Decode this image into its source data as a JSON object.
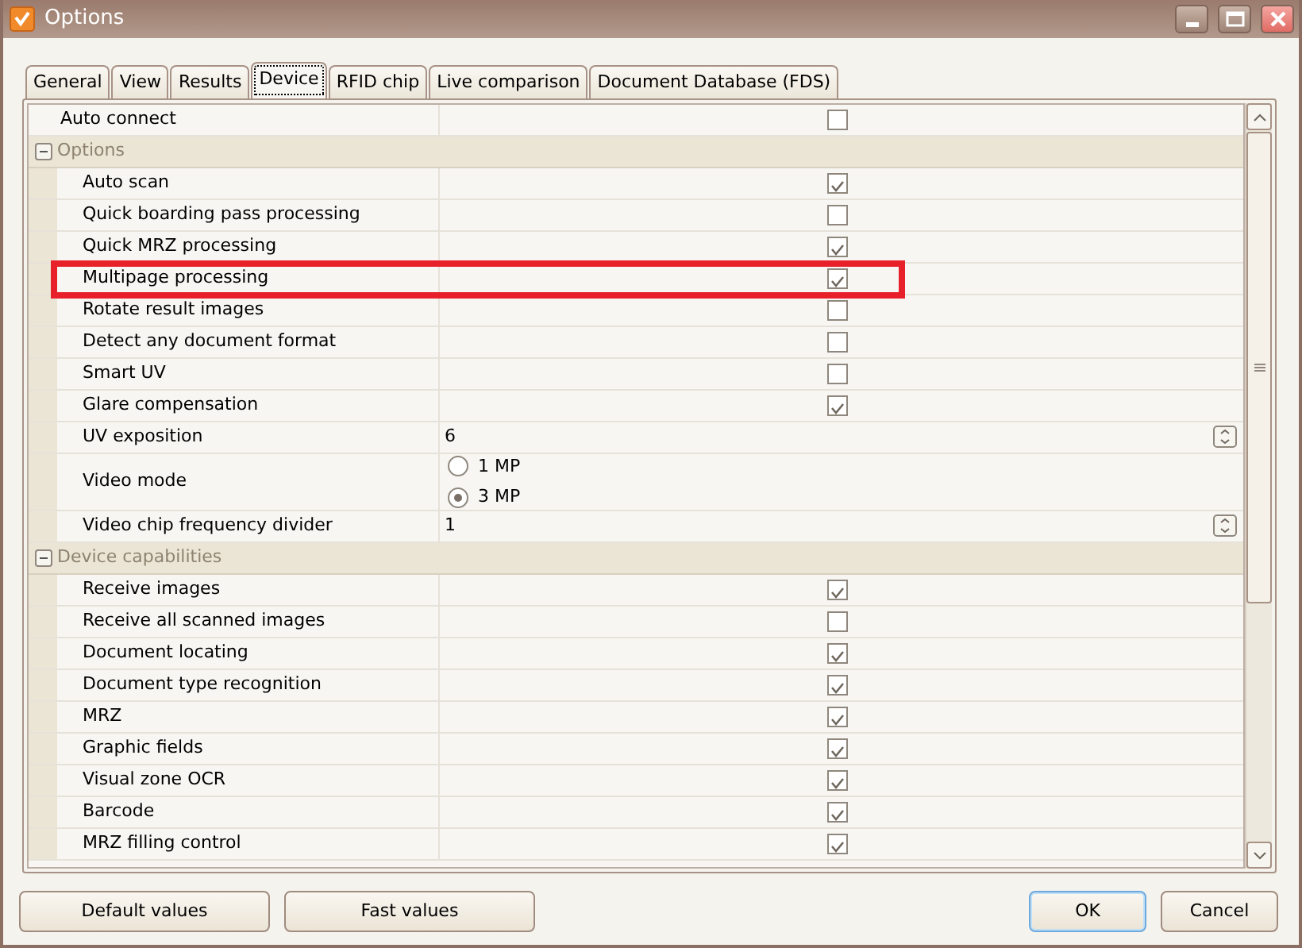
{
  "window": {
    "title": "Options"
  },
  "tabs": [
    {
      "label": "General",
      "selected": false
    },
    {
      "label": "View",
      "selected": false
    },
    {
      "label": "Results",
      "selected": false
    },
    {
      "label": "Device",
      "selected": true
    },
    {
      "label": "RFID chip",
      "selected": false
    },
    {
      "label": "Live comparison",
      "selected": false
    },
    {
      "label": "Document Database (FDS)",
      "selected": false
    }
  ],
  "properties": [
    {
      "kind": "checkbox",
      "label": "Auto connect",
      "checked": false
    },
    {
      "kind": "group",
      "label": "Options",
      "expanded": true,
      "children": [
        {
          "kind": "checkbox",
          "label": "Auto scan",
          "checked": true
        },
        {
          "kind": "checkbox",
          "label": "Quick boarding pass processing",
          "checked": false
        },
        {
          "kind": "checkbox",
          "label": "Quick MRZ processing",
          "checked": true
        },
        {
          "kind": "checkbox",
          "label": "Multipage processing",
          "checked": true,
          "highlighted": true
        },
        {
          "kind": "checkbox",
          "label": "Rotate result images",
          "checked": false
        },
        {
          "kind": "checkbox",
          "label": "Detect any document format",
          "checked": false
        },
        {
          "kind": "checkbox",
          "label": "Smart UV",
          "checked": false
        },
        {
          "kind": "checkbox",
          "label": "Glare compensation",
          "checked": true
        },
        {
          "kind": "number",
          "label": "UV exposition",
          "value": "6"
        },
        {
          "kind": "radio",
          "label": "Video mode",
          "options": [
            {
              "label": "1 MP",
              "selected": false
            },
            {
              "label": "3 MP",
              "selected": true
            }
          ]
        },
        {
          "kind": "number",
          "label": "Video chip frequency divider",
          "value": "1"
        }
      ]
    },
    {
      "kind": "group",
      "label": "Device capabilities",
      "expanded": true,
      "children": [
        {
          "kind": "checkbox",
          "label": "Receive images",
          "checked": true
        },
        {
          "kind": "checkbox",
          "label": "Receive all scanned images",
          "checked": false
        },
        {
          "kind": "checkbox",
          "label": "Document locating",
          "checked": true
        },
        {
          "kind": "checkbox",
          "label": "Document type recognition",
          "checked": true
        },
        {
          "kind": "checkbox",
          "label": "MRZ",
          "checked": true
        },
        {
          "kind": "checkbox",
          "label": "Graphic fields",
          "checked": true
        },
        {
          "kind": "checkbox",
          "label": "Visual zone OCR",
          "checked": true
        },
        {
          "kind": "checkbox",
          "label": "Barcode",
          "checked": true
        },
        {
          "kind": "checkbox",
          "label": "MRZ filling control",
          "checked": true
        }
      ]
    }
  ],
  "buttons": [
    {
      "label": "Default values",
      "kind": "left",
      "default": false
    },
    {
      "label": "Fast values",
      "kind": "left",
      "default": false
    },
    {
      "label": "OK",
      "kind": "right",
      "default": true
    },
    {
      "label": "Cancel",
      "kind": "right",
      "default": false
    }
  ]
}
